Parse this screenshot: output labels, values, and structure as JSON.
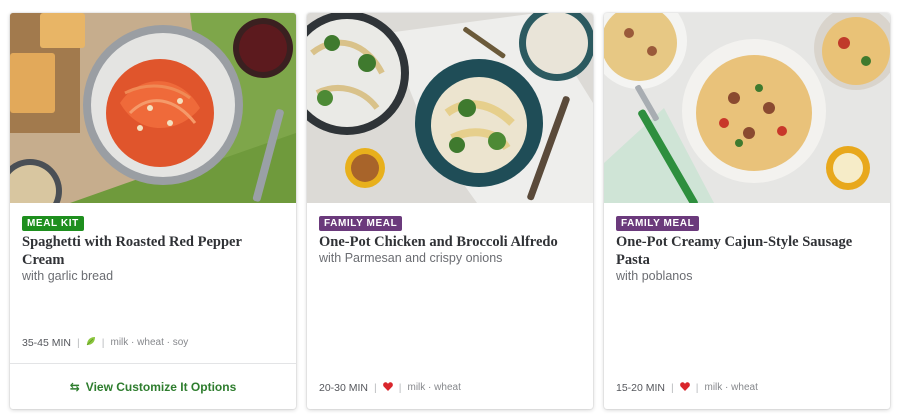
{
  "colors": {
    "meal_kit_badge": "#1e8f1e",
    "family_meal_badge": "#6b3a7c",
    "link_green": "#2e7d2e",
    "heart_red": "#d9262c",
    "leaf_green": "#8cc63f"
  },
  "cards": [
    {
      "badge": "MEAL KIT",
      "title": "Spaghetti with Roasted Red Pepper Cream",
      "subtitle": "with garlic bread",
      "time": "35-45 MIN",
      "diet_icon": "leaf-icon",
      "allergens": "milk · wheat · soy",
      "action_label": "View Customize It Options",
      "action_icon": "swap-arrows-icon"
    },
    {
      "badge": "FAMILY MEAL",
      "title": "One-Pot Chicken and Broccoli Alfredo",
      "subtitle": "with Parmesan and crispy onions",
      "time": "20-30 MIN",
      "diet_icon": "heart-icon",
      "allergens": "milk · wheat"
    },
    {
      "badge": "FAMILY MEAL",
      "title": "One-Pot Creamy Cajun-Style Sausage Pasta",
      "subtitle": "with poblanos",
      "time": "15-20 MIN",
      "diet_icon": "heart-icon",
      "allergens": "milk · wheat"
    }
  ]
}
